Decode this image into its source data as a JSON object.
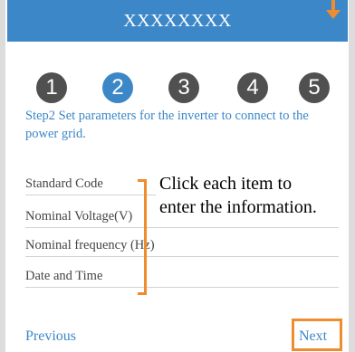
{
  "header": {
    "title": "XXXXXXXX"
  },
  "steps": [
    {
      "label": "1",
      "active": false
    },
    {
      "label": "2",
      "active": true
    },
    {
      "label": "3",
      "active": false
    },
    {
      "label": "4",
      "active": false
    },
    {
      "label": "5",
      "active": false
    }
  ],
  "step_description": "Step2 Set parameters for the inverter to connect to the power grid.",
  "fields": [
    {
      "label": "Standard Code"
    },
    {
      "label": "Nominal Voltage(V)"
    },
    {
      "label": "Nominal frequency (Hz)"
    },
    {
      "label": "Date and Time"
    }
  ],
  "callout": {
    "line1": "Click each item to",
    "line2": "enter the information."
  },
  "nav": {
    "previous_label": "Previous",
    "next_label": "Next"
  },
  "colors": {
    "accent": "#3c87c8",
    "highlight": "#ef8c2d",
    "step_inactive": "#505050"
  },
  "icons": {
    "top_right_arrow": "arrow-down-icon"
  }
}
